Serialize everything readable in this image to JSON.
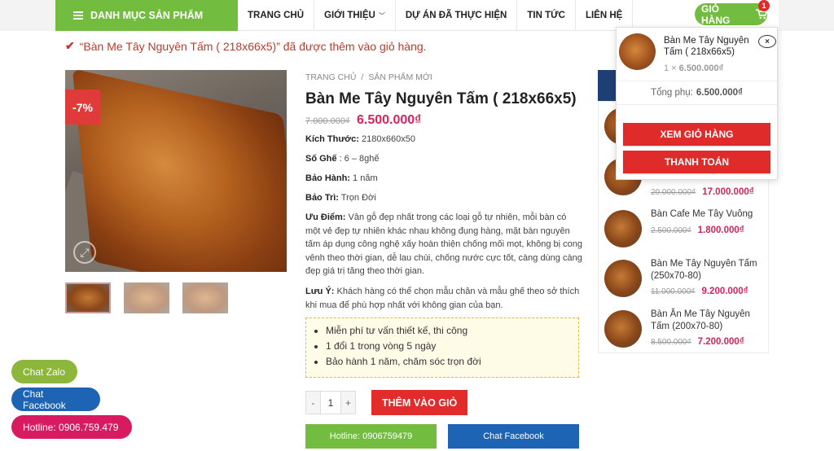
{
  "nav": {
    "category_label": "DANH MỤC SẢN PHẨM",
    "items": [
      "TRANG CHỦ",
      "GIỚI THIỆU",
      "DỰ ÁN ĐÃ THỰC HIỆN",
      "TIN TỨC",
      "LIÊN HỆ"
    ],
    "cart_label": "GIỎ HÀNG",
    "cart_count": "1"
  },
  "notice": "“Bàn Me Tây Nguyên Tấm ( 218x66x5)” đã được thêm vào giỏ hàng.",
  "product": {
    "sale_badge": "-7%",
    "breadcrumb": [
      "TRANG CHỦ",
      "SẢN PHẨM MỚI"
    ],
    "breadcrumb_sep": "/",
    "title": "Bàn Me Tây Nguyên Tấm ( 218x66x5)",
    "old_price": "7.000.000₫",
    "new_price": "6.500.000₫",
    "specs": [
      {
        "label": "Kích Thước:",
        "value": " 2180x660x50"
      },
      {
        "label": "Số Ghế",
        "value": " : 6 – 8ghế"
      },
      {
        "label": "Bảo Hành:",
        "value": " 1 năm"
      },
      {
        "label": "Bảo Trì:",
        "value": " Trọn Đời"
      }
    ],
    "advantage_label": "Ưu Điểm:",
    "advantage_text": " Vân gỗ đẹp nhất trong các loại gỗ tự nhiên, mỗi bàn có một vẻ đẹp tự nhiên khác nhau không đụng hàng, mặt bàn nguyên tấm áp dụng công nghệ xấy hoàn thiện chống mối mọt, không bị cong vênh theo thời gian, dễ lau chùi, chống nước cực tốt, càng dùng càng đẹp giá trị tăng theo thời gian.",
    "note_label": "Lưu Ý:",
    "note_text": " Khách hàng có thể chọn mẫu chân và mẫu ghế theo sở thích khi mua để phù hợp nhất với không gian của bạn.",
    "benefits": [
      "Miễn phí tư vấn thiết kế, thi công",
      "1 đổi 1 trong vòng 5 ngày",
      "Bảo hành 1 năm, chăm sóc trọn đời"
    ],
    "qty": "1",
    "qty_minus": "-",
    "qty_plus": "+",
    "add_to_cart": "THÊM VÀO GIỎ",
    "hotline_btn": "Hotline: 0906759479",
    "facebook_btn": "Chat Facebook"
  },
  "sidebar": [
    {
      "name": "",
      "old": "20.000.000₫",
      "new": "17.000.000₫"
    },
    {
      "name": "Bàn Cafe Me Tây Vuông",
      "old": "2.500.000₫",
      "new": "1.800.000₫"
    },
    {
      "name": "Bàn Me Tây Nguyên Tấm (250x70-80)",
      "old": "11.000.000₫",
      "new": "9.200.000₫"
    },
    {
      "name": "Bàn Ăn Me Tây Nguyên Tấm (200x70-80)",
      "old": "8.500.000₫",
      "new": "7.200.000₫"
    }
  ],
  "cart_dropdown": {
    "item_name": "Bàn Me Tây Nguyên Tấm ( 218x66x5)",
    "item_qty": "1 ×",
    "item_price": "6.500.000₫",
    "remove": "×",
    "subtotal_label": "Tổng phụ:",
    "subtotal_value": "6.500.000₫",
    "view_cart": "XEM GIỎ HÀNG",
    "checkout": "THANH TOÁN"
  },
  "floating": {
    "zalo": "Chat Zalo",
    "facebook": "Chat Facebook",
    "hotline": "Hotline: 0906.759.479"
  },
  "colors": {
    "green": "#72bd3f",
    "red": "#e22b2b",
    "price": "#d6245a",
    "blue": "#1e64b4",
    "pink": "#d81b60"
  }
}
